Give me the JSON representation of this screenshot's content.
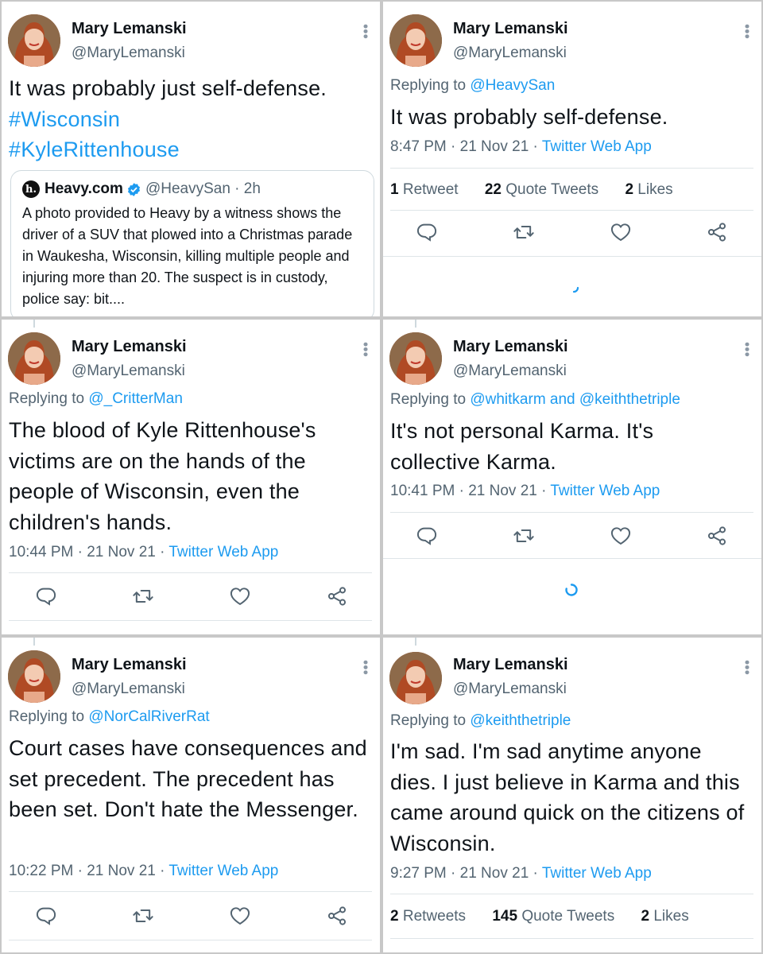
{
  "user": {
    "name": "Mary Lemanski",
    "handle": "@MaryLemanski"
  },
  "tweets": [
    {
      "text": "It was probably just self-defense.",
      "hashtags": [
        "#Wisconsin",
        "#KyleRittenhouse"
      ],
      "quote": {
        "name": "Heavy.com",
        "handle": "@HeavySan",
        "dot": "·",
        "time": "2h",
        "logo": "h.",
        "text": "A photo provided to Heavy by a witness shows the driver of a SUV that plowed into a Christmas parade in Waukesha, Wisconsin, killing multiple people and injuring more than 20. The suspect is in custody, police say: bit...."
      }
    },
    {
      "reply_prefix": "Replying to ",
      "reply_to": "@HeavySan",
      "text": "It was probably self-defense.",
      "time": "8:47 PM · 21 Nov 21 · ",
      "source": "Twitter Web App",
      "stats": {
        "retweets_num": "1",
        "retweets_label": "Retweet",
        "quotes_num": "22",
        "quotes_label": "Quote Tweets",
        "likes_num": "2",
        "likes_label": "Likes"
      }
    },
    {
      "reply_prefix": "Replying to ",
      "reply_to": "@_CritterMan",
      "text": "The blood of Kyle Rittenhouse's victims are on the hands of the people of Wisconsin, even the children's hands.",
      "time": "10:44 PM · 21 Nov 21 · ",
      "source": "Twitter Web App"
    },
    {
      "reply_prefix": "Replying to ",
      "reply_to": "@whitkarm and @keiththetriple",
      "text": "It's not personal Karma. It's collective Karma.",
      "time": "10:41 PM · 21 Nov 21 · ",
      "source": "Twitter Web App"
    },
    {
      "reply_prefix": "Replying to ",
      "reply_to": "@NorCalRiverRat",
      "text": "Court cases have consequences and set precedent. The precedent has been set. Don't hate the Messenger.",
      "time": "10:22 PM · 21 Nov 21 · ",
      "source": "Twitter Web App"
    },
    {
      "reply_prefix": "Replying to ",
      "reply_to": "@keiththetriple",
      "text": "I'm sad. I'm sad anytime anyone dies. I just believe in Karma and this came around quick on the citizens of Wisconsin.",
      "time": "9:27 PM · 21 Nov 21 · ",
      "source": "Twitter Web App",
      "stats": {
        "retweets_num": "2",
        "retweets_label": "Retweets",
        "quotes_num": "145",
        "quotes_label": "Quote Tweets",
        "likes_num": "2",
        "likes_label": "Likes"
      }
    }
  ],
  "icons": [
    "reply-icon",
    "retweet-icon",
    "like-icon",
    "share-icon",
    "more-icon",
    "verified-icon",
    "loading-spinner-icon"
  ],
  "colors": {
    "link": "#1d9bf0",
    "muted": "#536471",
    "text": "#0f1419",
    "divider": "#dfe5e8"
  }
}
